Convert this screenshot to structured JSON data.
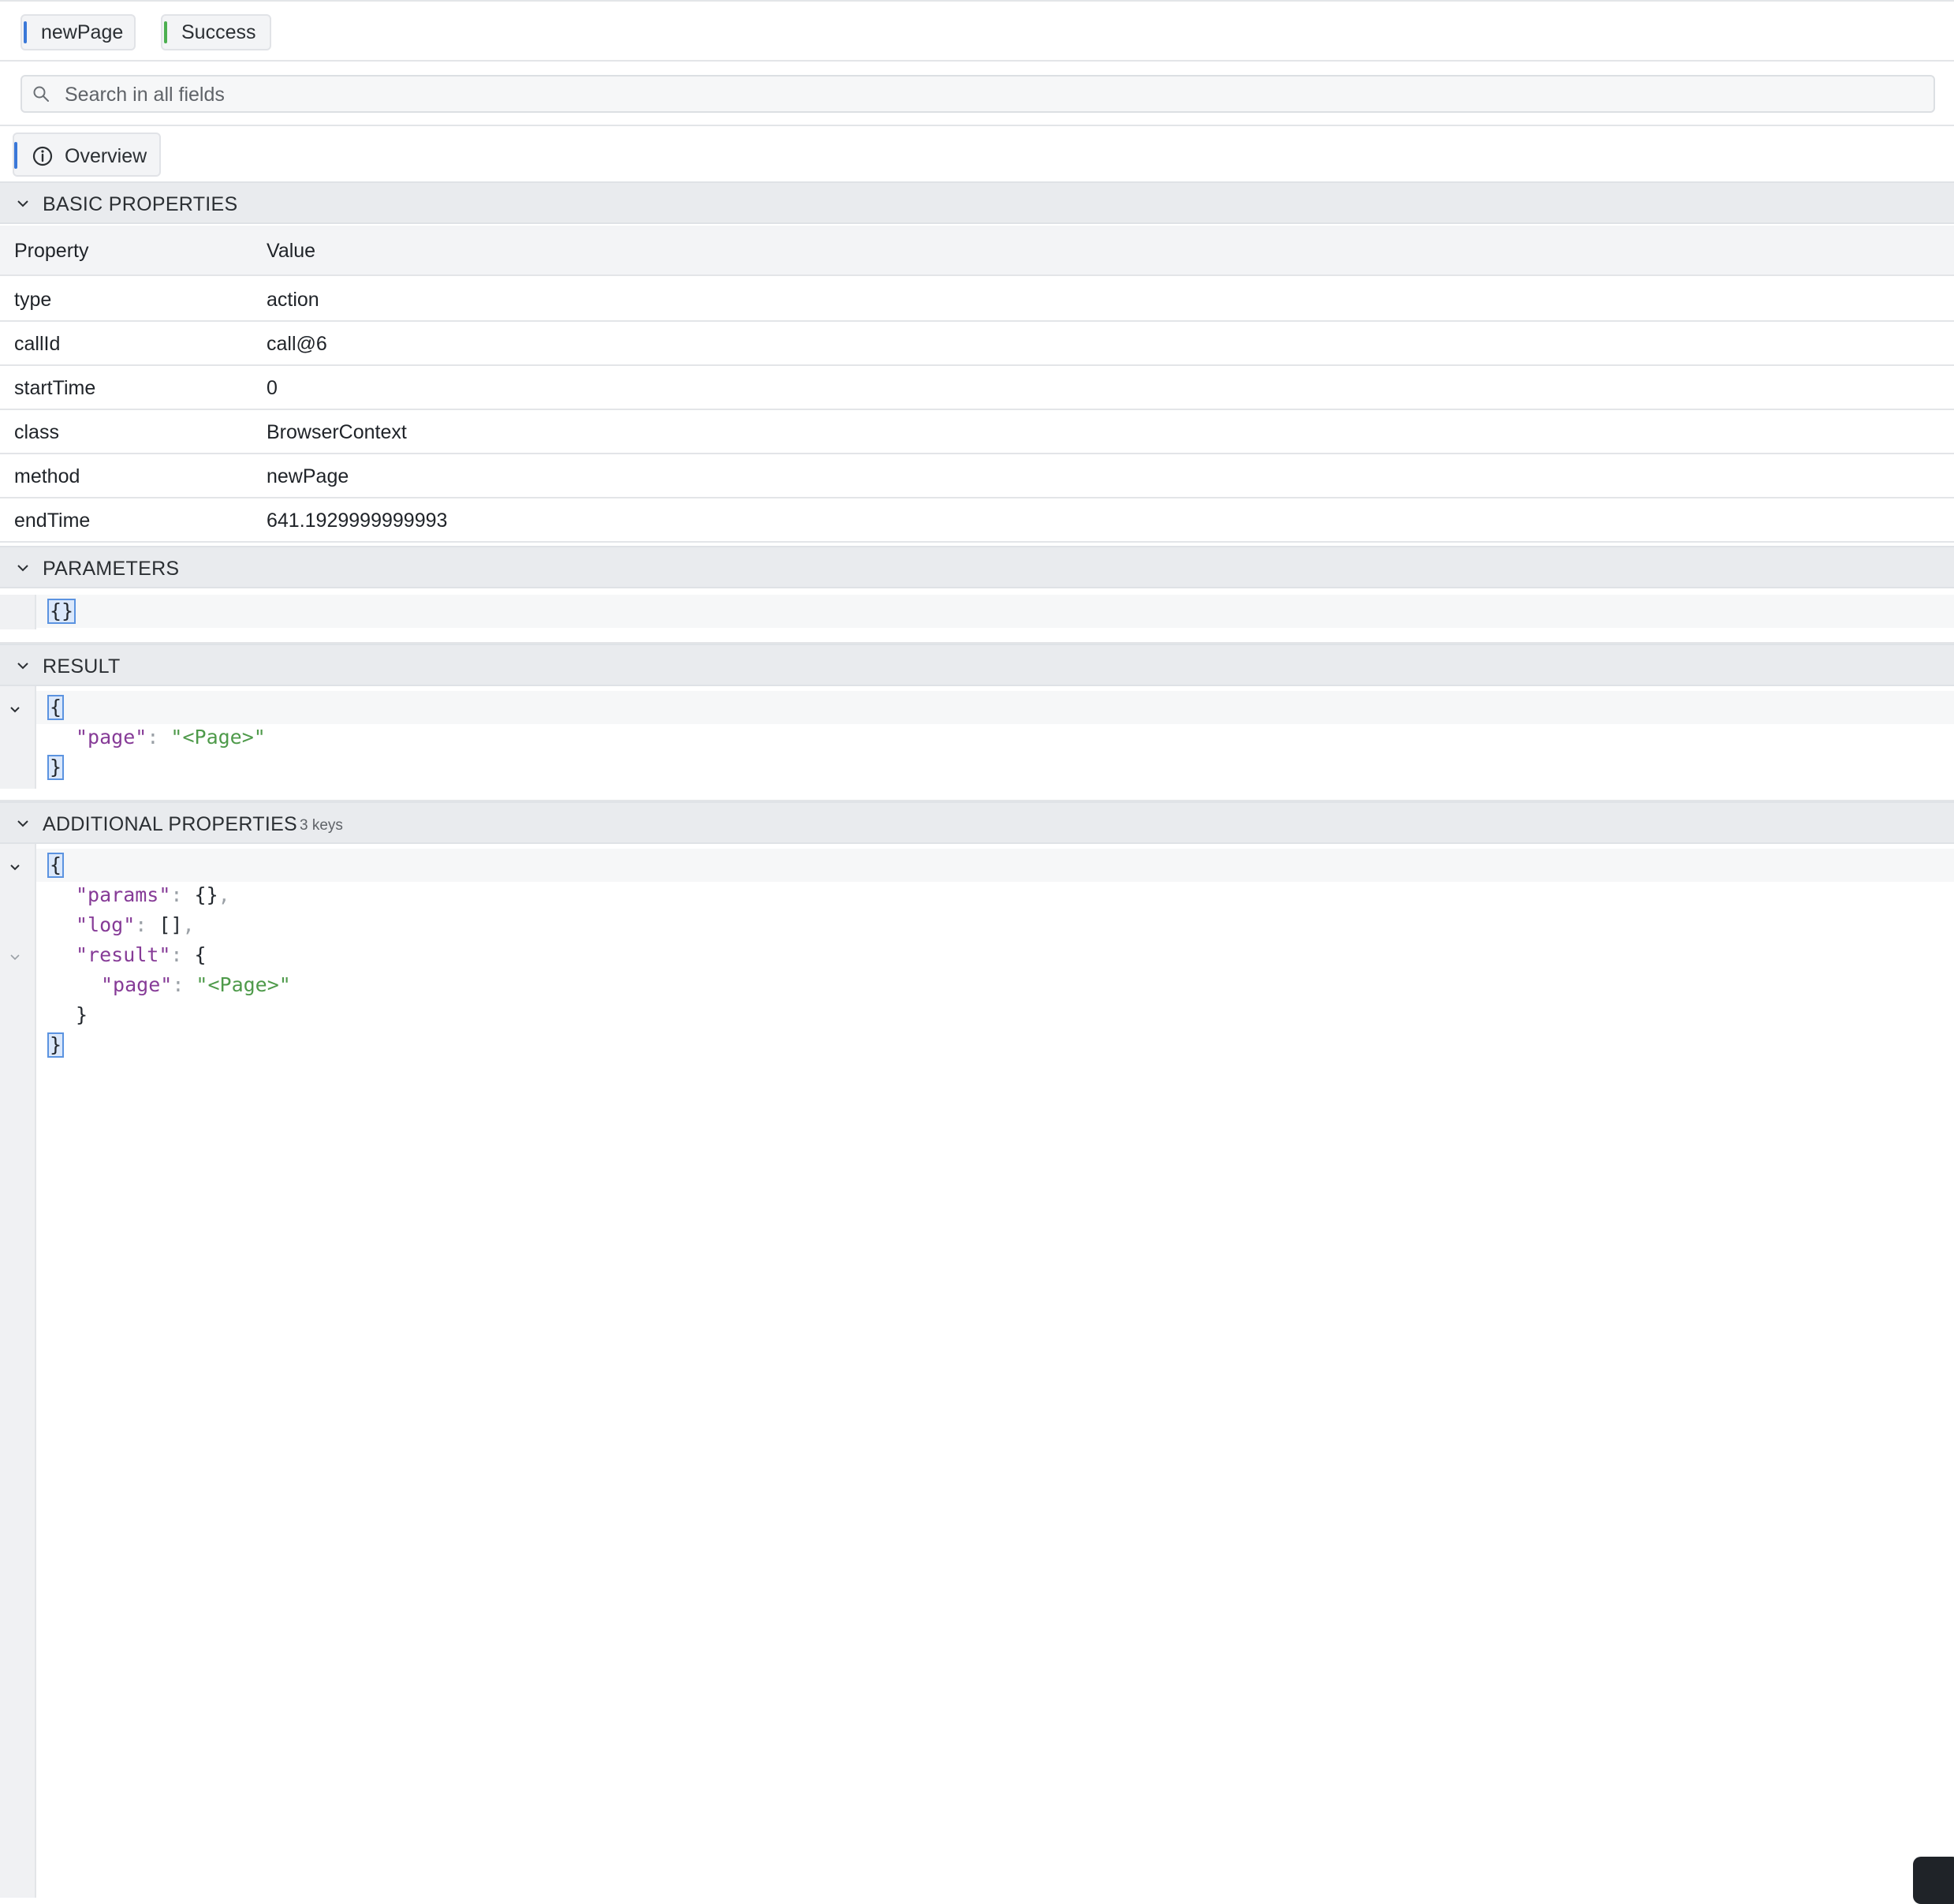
{
  "header": {
    "chips": [
      {
        "label": "newPage",
        "color": "#3a78d8"
      },
      {
        "label": "Success",
        "color": "#4caf50"
      }
    ]
  },
  "search": {
    "placeholder": "Search in all fields",
    "value": ""
  },
  "tabs": [
    {
      "label": "Overview",
      "icon": "info-icon"
    }
  ],
  "sections": {
    "basic": {
      "title": "BASIC PROPERTIES",
      "columns": [
        "Property",
        "Value"
      ],
      "rows": [
        {
          "property": "type",
          "value": "action"
        },
        {
          "property": "callId",
          "value": "call@6"
        },
        {
          "property": "startTime",
          "value": "0"
        },
        {
          "property": "class",
          "value": "BrowserContext"
        },
        {
          "property": "method",
          "value": "newPage"
        },
        {
          "property": "endTime",
          "value": "641.1929999999993"
        }
      ]
    },
    "parameters": {
      "title": "PARAMETERS",
      "json": "{}"
    },
    "result": {
      "title": "RESULT",
      "open_brace": "{",
      "close_brace": "}",
      "key": "\"page\"",
      "colon": ": ",
      "value": "\"<Page>\""
    },
    "additional": {
      "title": "ADDITIONAL PROPERTIES",
      "count": "3 keys",
      "open_brace": "{",
      "close_brace": "}",
      "lines": {
        "params_key": "\"params\"",
        "params_value": "{}",
        "log_key": "\"log\"",
        "log_value": "[]",
        "result_key": "\"result\"",
        "result_open": "{",
        "page_key": "\"page\"",
        "page_value": "\"<Page>\"",
        "result_close": "}"
      },
      "colon": ": ",
      "comma": ","
    }
  }
}
